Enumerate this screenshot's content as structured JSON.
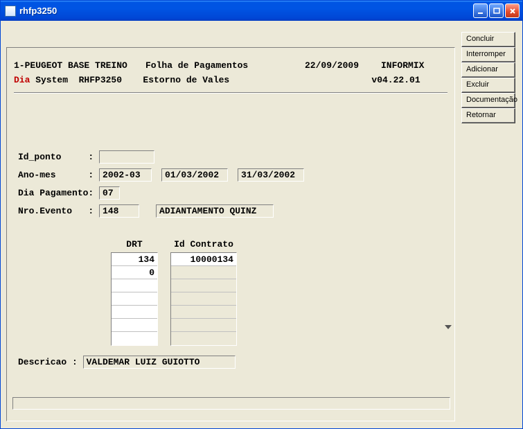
{
  "window": {
    "title": "rhfp3250"
  },
  "side": {
    "concluir": "Concluir",
    "interromper": "Interromper",
    "adicionar": "Adicionar",
    "excluir": "Excluir",
    "documentacao": "Documentação",
    "retornar": "Retornar"
  },
  "header": {
    "line1_left": "1-PEUGEOT BASE TREINO",
    "line1_mid": "Folha de Pagamentos",
    "line1_date": "22/09/2009",
    "line1_right": "INFORMIX",
    "line2_red": "Dia",
    "line2_system": " System  RHFP3250",
    "line2_mid": "Estorno de Vales",
    "line2_ver": "v04.22.01"
  },
  "form": {
    "id_ponto_label": "Id_ponto     : ",
    "id_ponto": "",
    "ano_mes_label": "Ano-mes      : ",
    "ano_mes": "2002-03",
    "data_ini": "01/03/2002",
    "data_fim": "31/03/2002",
    "dia_pag_label": "Dia Pagamento: ",
    "dia_pag": "07",
    "nro_evento_label": "Nro.Evento   : ",
    "nro_evento": "148",
    "nro_evento_desc": "ADIANTAMENTO QUINZ"
  },
  "grid": {
    "drt_header": "DRT",
    "contrato_header": "Id Contrato",
    "drt": [
      "134",
      "0",
      "",
      "",
      "",
      "",
      ""
    ],
    "drt_editing_index": 1,
    "contrato": [
      "10000134",
      "",
      "",
      "",
      "",
      "",
      ""
    ]
  },
  "descricao": {
    "label": "Descricao : ",
    "value": "VALDEMAR LUIZ GUIOTTO"
  }
}
